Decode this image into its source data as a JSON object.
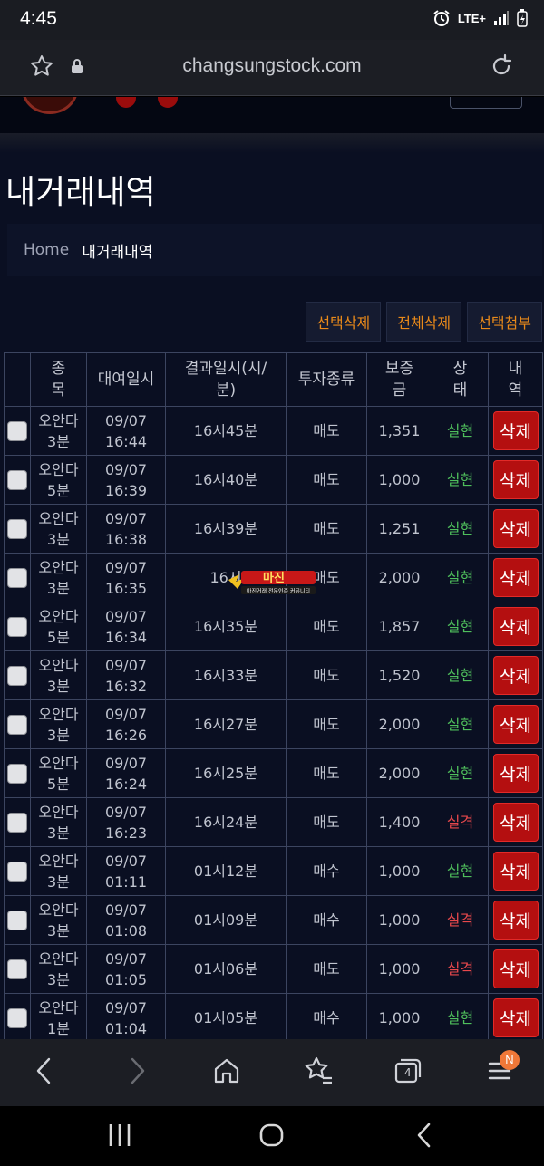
{
  "status_bar": {
    "time": "4:45",
    "network": "LTE+"
  },
  "browser": {
    "url": "changsungstock.com",
    "tab_count": "4",
    "menu_badge": "N"
  },
  "page": {
    "title": "내거래내역",
    "breadcrumb": {
      "home": "Home",
      "current": "내거래내역"
    },
    "actions": {
      "delete_selected": "선택삭제",
      "delete_all": "전체삭제",
      "attach_selected": "선택첨부"
    }
  },
  "table": {
    "headers": [
      "종목",
      "대여일시",
      "결과일시(시/분)",
      "투자종류",
      "보증금",
      "상태",
      "내역"
    ],
    "delete_label": "삭제",
    "rows": [
      {
        "item": "오안다 3분",
        "date": "09/07 16:44",
        "result_time": "16시45분",
        "type": "매도",
        "deposit": "1,351",
        "status": "실현"
      },
      {
        "item": "오안다 5분",
        "date": "09/07 16:39",
        "result_time": "16시40분",
        "type": "매도",
        "deposit": "1,000",
        "status": "실현"
      },
      {
        "item": "오안다 3분",
        "date": "09/07 16:38",
        "result_time": "16시39분",
        "type": "매도",
        "deposit": "1,251",
        "status": "실현"
      },
      {
        "item": "오안다 3분",
        "date": "09/07 16:35",
        "result_time": "16시",
        "type": "매도",
        "deposit": "2,000",
        "status": "실현"
      },
      {
        "item": "오안다 5분",
        "date": "09/07 16:34",
        "result_time": "16시35분",
        "type": "매도",
        "deposit": "1,857",
        "status": "실현"
      },
      {
        "item": "오안다 3분",
        "date": "09/07 16:32",
        "result_time": "16시33분",
        "type": "매도",
        "deposit": "1,520",
        "status": "실현"
      },
      {
        "item": "오안다 3분",
        "date": "09/07 16:26",
        "result_time": "16시27분",
        "type": "매도",
        "deposit": "2,000",
        "status": "실현"
      },
      {
        "item": "오안다 5분",
        "date": "09/07 16:24",
        "result_time": "16시25분",
        "type": "매도",
        "deposit": "2,000",
        "status": "실현"
      },
      {
        "item": "오안다 3분",
        "date": "09/07 16:23",
        "result_time": "16시24분",
        "type": "매도",
        "deposit": "1,400",
        "status": "실격"
      },
      {
        "item": "오안다 3분",
        "date": "09/07 01:11",
        "result_time": "01시12분",
        "type": "매수",
        "deposit": "1,000",
        "status": "실현"
      },
      {
        "item": "오안다 3분",
        "date": "09/07 01:08",
        "result_time": "01시09분",
        "type": "매수",
        "deposit": "1,000",
        "status": "실격"
      },
      {
        "item": "오안다 3분",
        "date": "09/07 01:05",
        "result_time": "01시06분",
        "type": "매도",
        "deposit": "1,000",
        "status": "실격"
      },
      {
        "item": "오안다 1분",
        "date": "09/07 01:04",
        "result_time": "01시05분",
        "type": "매수",
        "deposit": "1,000",
        "status": "실현"
      }
    ]
  },
  "watermark": {
    "title": "마진",
    "sub": "마진거래 전문인증 커뮤니티"
  },
  "colors": {
    "status_ok": "#4fbf5c",
    "status_fail": "#e8484c",
    "delete_button": "#b40f10",
    "action_text": "#e8891a",
    "page_bg": "#0a0f22"
  },
  "icons": [
    "star-icon",
    "lock-icon",
    "reload-icon",
    "back-icon",
    "forward-icon",
    "home-icon",
    "bookmarks-icon",
    "tabs-icon",
    "menu-icon",
    "recents-icon",
    "system-home-icon",
    "system-back-icon"
  ]
}
